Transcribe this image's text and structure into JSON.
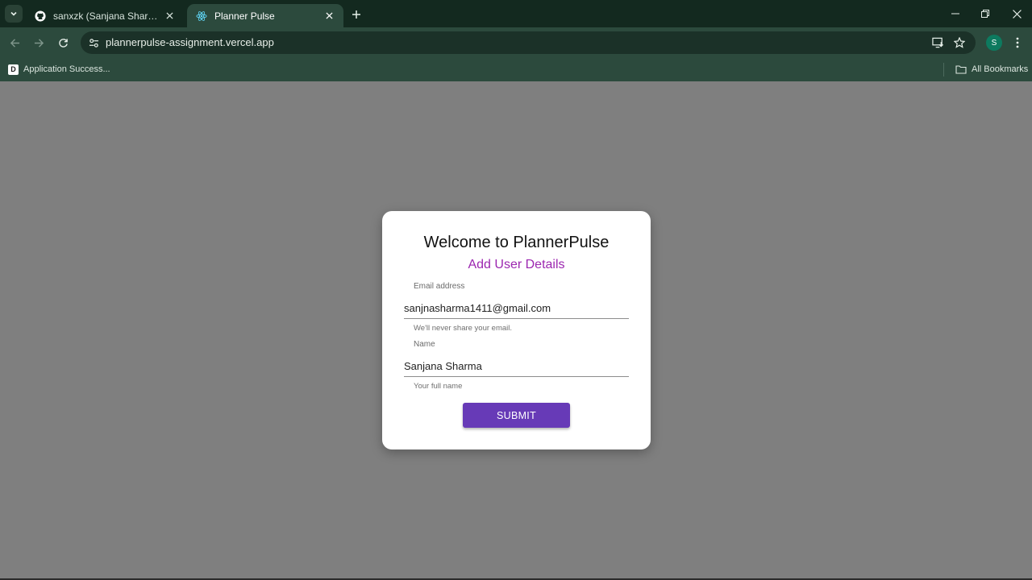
{
  "tabs": [
    {
      "title": "sanxzk (Sanjana Sharma)",
      "icon": "github-icon",
      "active": false
    },
    {
      "title": "Planner Pulse",
      "icon": "react-icon",
      "active": true
    }
  ],
  "address_bar": {
    "url": "plannerpulse-assignment.vercel.app"
  },
  "profile": {
    "initial": "S"
  },
  "bookmarks": {
    "items": [
      {
        "label": "Application Success...",
        "icon_text": "D"
      }
    ],
    "all_label": "All Bookmarks"
  },
  "form": {
    "title": "Welcome to PlannerPulse",
    "subtitle": "Add User Details",
    "email": {
      "label": "Email address",
      "value": "sanjnasharma1411@gmail.com",
      "helper": "We'll never share your email."
    },
    "name": {
      "label": "Name",
      "value": "Sanjana Sharma",
      "helper": "Your full name"
    },
    "submit_label": "SUBMIT"
  },
  "colors": {
    "accent": "#673ab7",
    "subtitle": "#9c27b0",
    "chrome": "#2c4a3d",
    "backdrop": "#7f7f7f"
  }
}
